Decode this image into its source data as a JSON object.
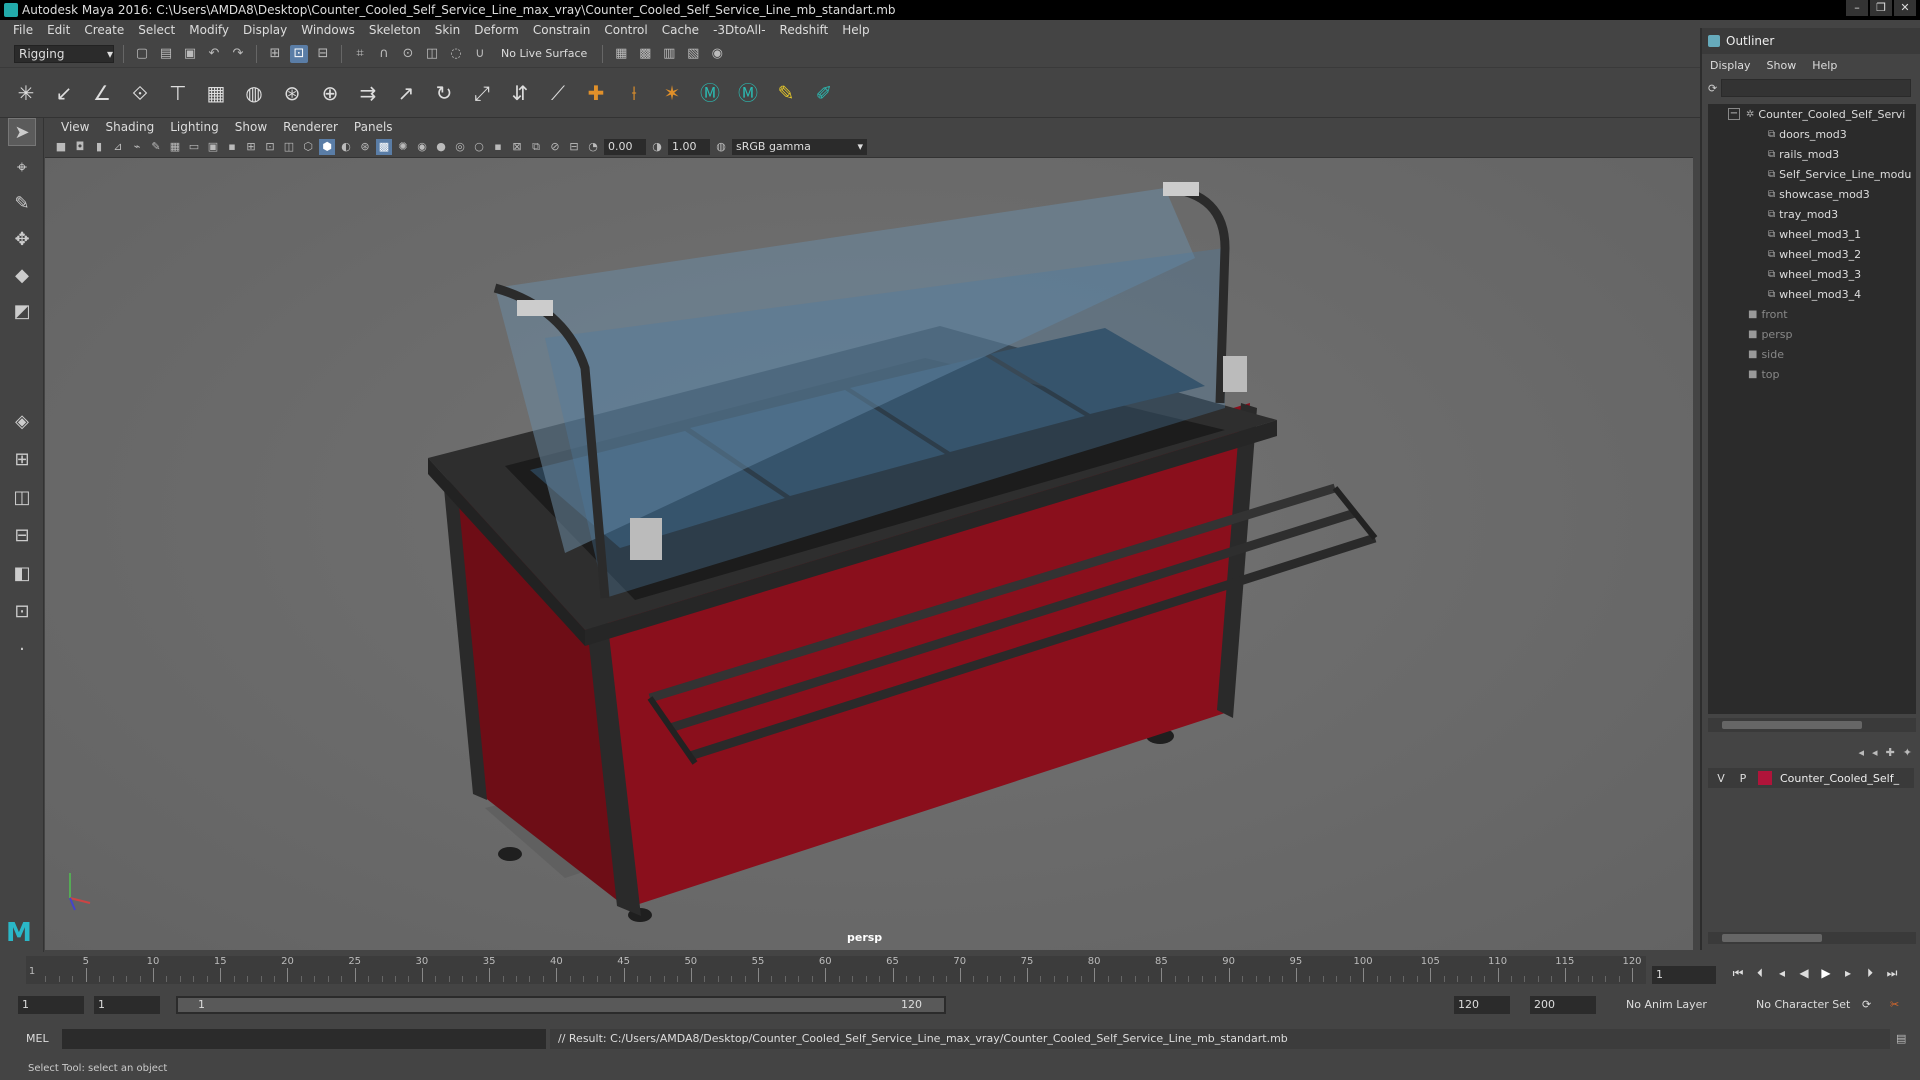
{
  "window": {
    "title": "Autodesk Maya 2016: C:\\Users\\AMDA8\\Desktop\\Counter_Cooled_Self_Service_Line_max_vray\\Counter_Cooled_Self_Service_Line_mb_standart.mb",
    "minimize": "–",
    "restore": "❐",
    "close": "✕"
  },
  "menubar": [
    "File",
    "Edit",
    "Create",
    "Select",
    "Modify",
    "Display",
    "Windows",
    "Skeleton",
    "Skin",
    "Deform",
    "Constrain",
    "Control",
    "Cache",
    "-3DtoAll-",
    "Redshift",
    "Help"
  ],
  "statusline": {
    "mode": "Rigging",
    "live_surface": "No Live Surface"
  },
  "viewport": {
    "menu": [
      "View",
      "Shading",
      "Lighting",
      "Show",
      "Renderer",
      "Panels"
    ],
    "exposure": "0.00",
    "gamma": "1.00",
    "color_space": "sRGB gamma",
    "camera_label": "persp"
  },
  "outliner": {
    "title": "Outliner",
    "menu": [
      "Display",
      "Show",
      "Help"
    ],
    "root": "Counter_Cooled_Self_Servi",
    "children": [
      "doors_mod3",
      "rails_mod3",
      "Self_Service_Line_modu",
      "showcase_mod3",
      "tray_mod3",
      "wheel_mod3_1",
      "wheel_mod3_2",
      "wheel_mod3_3",
      "wheel_mod3_4"
    ],
    "cameras": [
      "front",
      "persp",
      "side",
      "top"
    ]
  },
  "layers": {
    "v": "V",
    "p": "P",
    "layer_name": "Counter_Cooled_Self_",
    "layer_color": "#b0143a"
  },
  "timeline": {
    "ticks": [
      "5",
      "10",
      "15",
      "20",
      "25",
      "30",
      "35",
      "40",
      "45",
      "50",
      "55",
      "60",
      "65",
      "70",
      "75",
      "80",
      "85",
      "90",
      "95",
      "100",
      "105",
      "110",
      "115",
      "120"
    ],
    "start_marker": "1",
    "current_frame": "1"
  },
  "range": {
    "start": "1",
    "playback_start": "1",
    "slider_start": "1",
    "slider_end": "120",
    "playback_end": "120",
    "end": "200",
    "anim_layer": "No Anim Layer",
    "character_set": "No Character Set"
  },
  "cmdline": {
    "mel_label": "MEL",
    "result": "// Result: C:/Users/AMDA8/Desktop/Counter_Cooled_Self_Service_Line_max_vray/Counter_Cooled_Self_Service_Line_mb_standart.mb"
  },
  "helpline": "Select Tool: select an object"
}
